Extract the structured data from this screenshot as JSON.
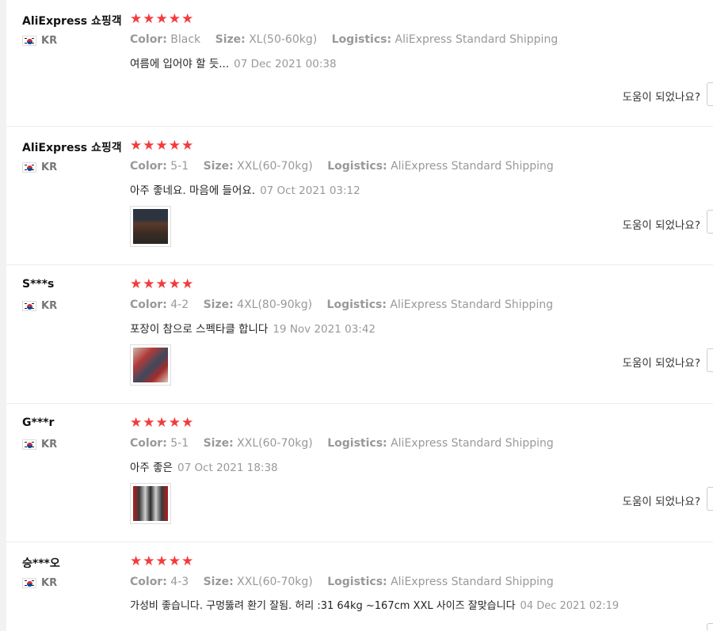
{
  "reviews": [
    {
      "user": "AliExpress 쇼핑객",
      "country": "KR",
      "stars": "★★★★★",
      "color_label": "Color:",
      "color": "Black",
      "size_label": "Size:",
      "size": "XL(50-60kg)",
      "logistics_label": "Logistics:",
      "logistics": "AliExpress Standard Shipping",
      "text": "여름에 입어야 할 듯...",
      "date": "07 Dec 2021 00:38",
      "helpful": "도움이 되었나요?"
    },
    {
      "user": "AliExpress 쇼핑객",
      "country": "KR",
      "stars": "★★★★★",
      "color_label": "Color:",
      "color": "5-1",
      "size_label": "Size:",
      "size": "XXL(60-70kg)",
      "logistics_label": "Logistics:",
      "logistics": "AliExpress Standard Shipping",
      "text": "아주 좋네요. 마음에 들어요.",
      "date": "07 Oct 2021 03:12",
      "helpful": "도움이 되었나요?"
    },
    {
      "user": "S***s",
      "country": "KR",
      "stars": "★★★★★",
      "color_label": "Color:",
      "color": "4-2",
      "size_label": "Size:",
      "size": "4XL(80-90kg)",
      "logistics_label": "Logistics:",
      "logistics": "AliExpress Standard Shipping",
      "text": "포장이 참으로 스펙타클 합니다",
      "date": "19 Nov 2021 03:42",
      "helpful": "도움이 되었나요?"
    },
    {
      "user": "G***r",
      "country": "KR",
      "stars": "★★★★★",
      "color_label": "Color:",
      "color": "5-1",
      "size_label": "Size:",
      "size": "XXL(60-70kg)",
      "logistics_label": "Logistics:",
      "logistics": "AliExpress Standard Shipping",
      "text": "아주 좋은",
      "date": "07 Oct 2021 18:38",
      "helpful": "도움이 되었나요?"
    },
    {
      "user": "승***오",
      "country": "KR",
      "stars": "★★★★★",
      "color_label": "Color:",
      "color": "4-3",
      "size_label": "Size:",
      "size": "XXL(60-70kg)",
      "logistics_label": "Logistics:",
      "logistics": "AliExpress Standard Shipping",
      "text": "가성비 좋습니다. 구멍뚫려 환기 잘됨. 허리 :31 64kg ~167cm XXL 사이즈 잘맞습니다",
      "date": "04 Dec 2021 02:19",
      "helpful": ""
    }
  ],
  "colors": {
    "star": "#f23c3c",
    "muted": "#999999"
  }
}
